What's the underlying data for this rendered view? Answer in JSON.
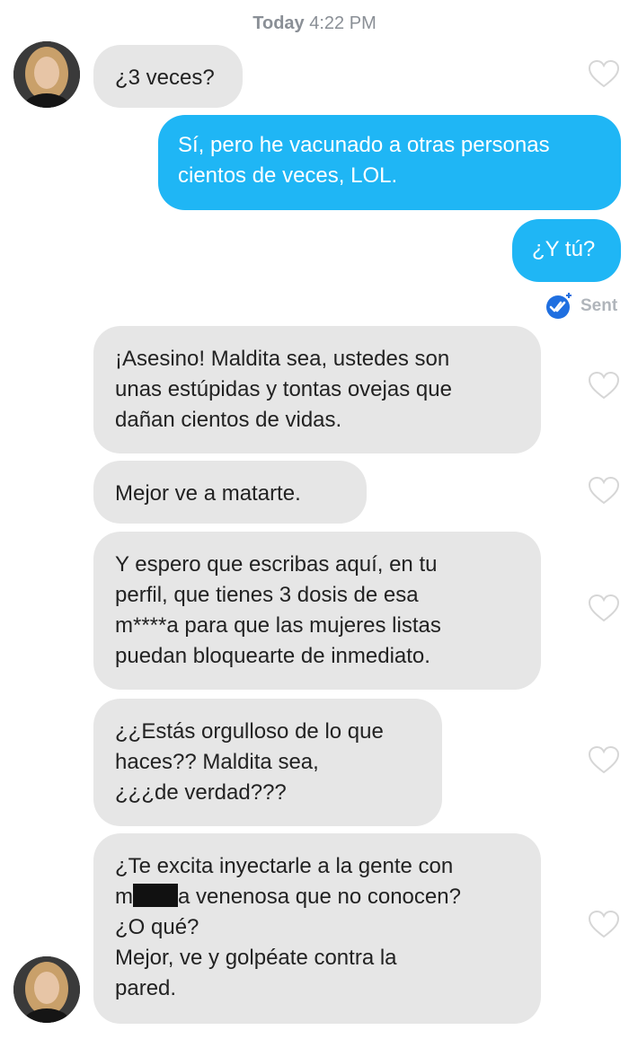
{
  "header": {
    "day": "Today",
    "time": "4:22 PM"
  },
  "colors": {
    "incoming_bubble": "#e6e6e6",
    "outgoing_bubble": "#1fb6f5",
    "sent_check": "#1f6fe0"
  },
  "messages": [
    {
      "from": "match",
      "text": "¿3 veces?"
    },
    {
      "from": "me",
      "text": "Sí, pero he vacunado a otras personas\ncientos de veces, LOL."
    },
    {
      "from": "me",
      "text": "¿Y tú?"
    },
    {
      "from": "match",
      "text": "¡Asesino! Maldita sea, ustedes son\nunas estúpidas y tontas ovejas que\ndañan cientos de vidas."
    },
    {
      "from": "match",
      "text": "Mejor ve a matarte."
    },
    {
      "from": "match",
      "text": "Y espero que escribas aquí, en tu\nperfil, que tienes 3 dosis de esa\nm****a para que las mujeres listas\npuedan bloquearte de inmediato."
    },
    {
      "from": "match",
      "text": "¿¿Estás orgulloso de lo que\nhaces?? Maldita sea,\n¿¿¿de verdad???"
    },
    {
      "from": "match",
      "parts": {
        "start": "¿Te excita inyectarle a la gente con\nm",
        "end": "a venenosa que no conocen?\n¿O qué?\nMejor, ve y golpéate contra la\npared."
      }
    }
  ],
  "status": {
    "sent_label": "Sent",
    "icon": "double-check-icon"
  }
}
